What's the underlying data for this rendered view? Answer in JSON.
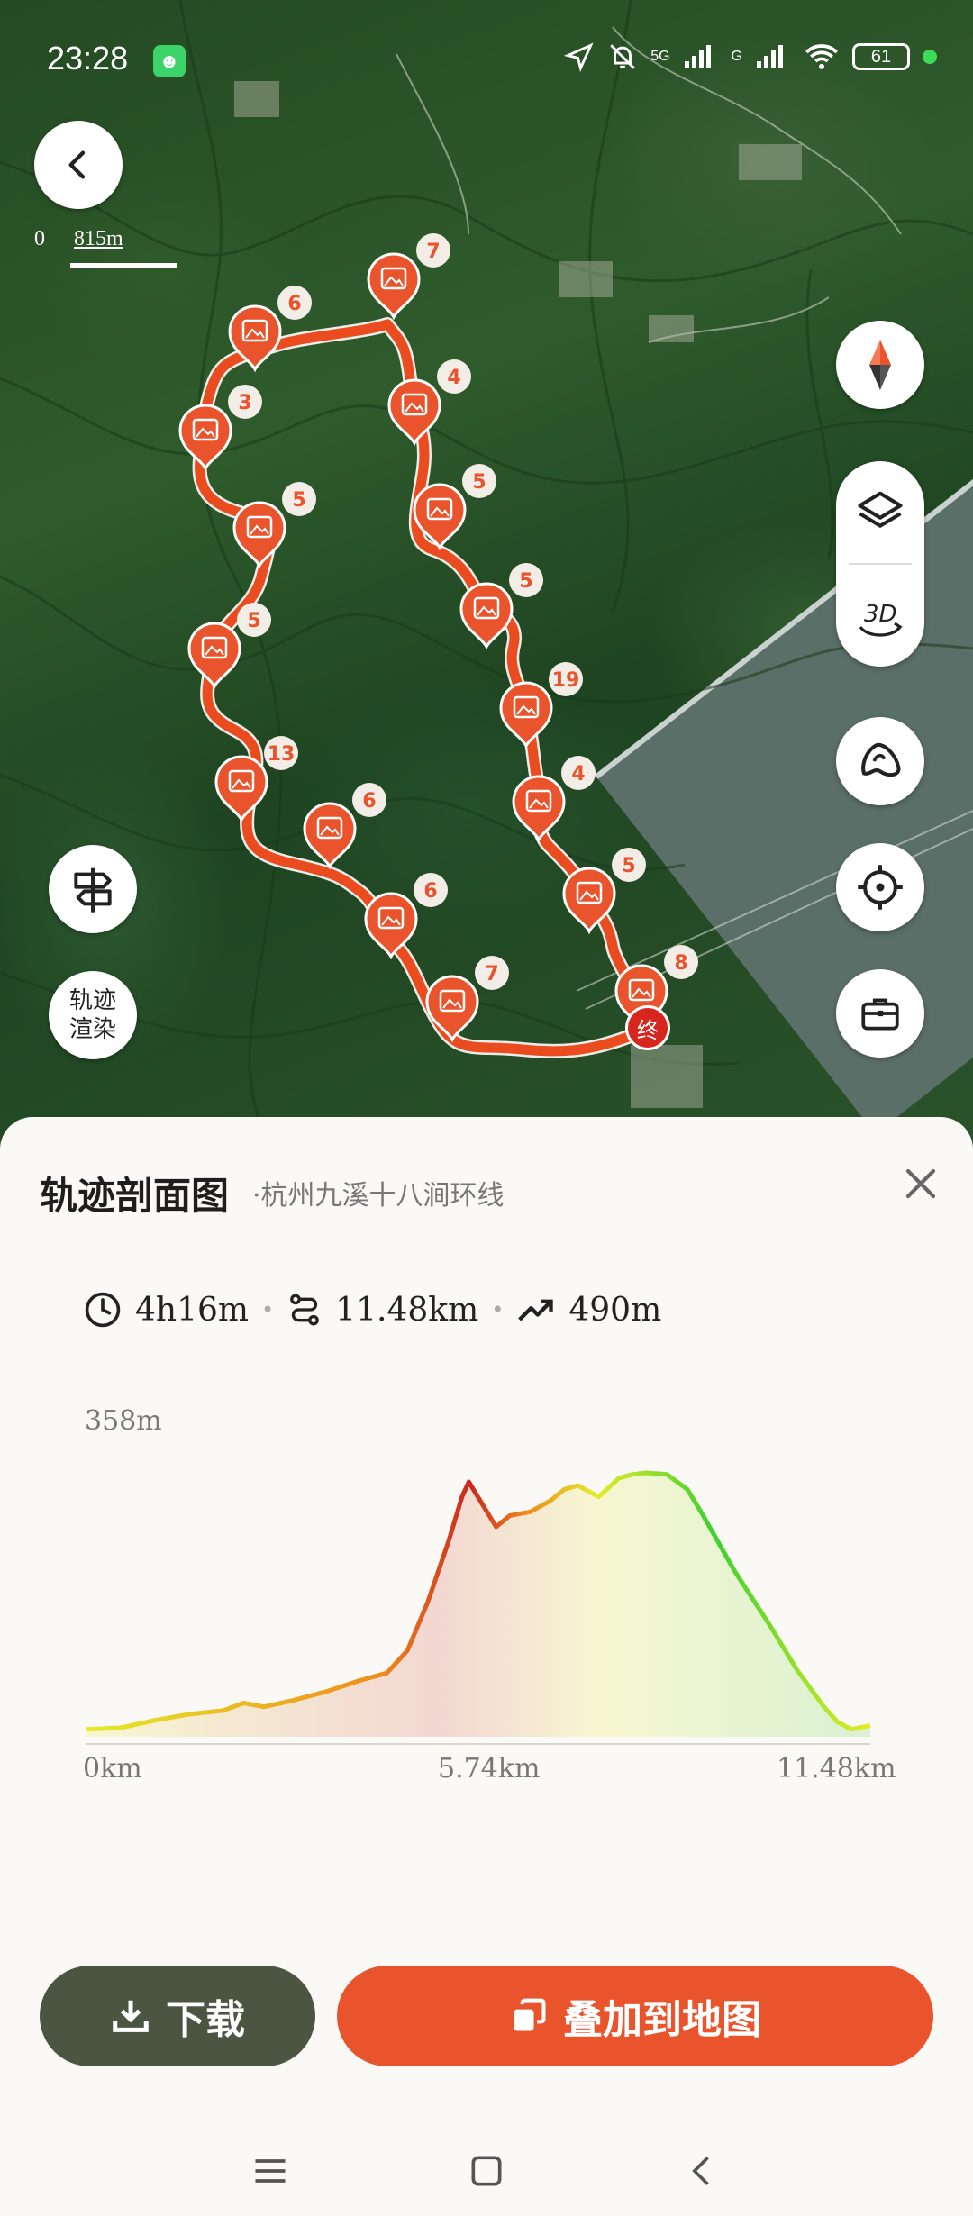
{
  "status_bar": {
    "time": "23:28",
    "network_label": "5G",
    "network_label_2": "G",
    "battery": "61"
  },
  "map": {
    "scale": {
      "zero": "0",
      "distance": "815m"
    },
    "end_marker_label": "终",
    "render_button_label_line1": "轨迹",
    "render_button_label_line2": "渲染",
    "photo_counts": [
      "7",
      "6",
      "4",
      "3",
      "5",
      "5",
      "5",
      "5",
      "19",
      "13",
      "4",
      "6",
      "5",
      "6",
      "7",
      "8"
    ],
    "icons": {
      "back": "chevron-left-icon",
      "compass": "compass-icon",
      "layers": "layers-icon",
      "view3d": "3d-view-icon",
      "terrain": "terrain-icon",
      "locate": "crosshair-icon",
      "toolbox": "toolbox-icon",
      "signpost": "signpost-icon"
    }
  },
  "sheet": {
    "title": "轨迹剖面图",
    "subtitle": "·杭州九溪十八涧环线",
    "stats": {
      "duration": "4h16m",
      "distance": "11.48km",
      "ascent": "490m"
    },
    "actions": {
      "download_label": "下载",
      "overlay_label": "叠加到地图"
    }
  },
  "chart_data": {
    "type": "area",
    "title": "",
    "xlabel": "",
    "ylabel": "",
    "y_max_label": "358m",
    "x_tick_labels": [
      "0km",
      "5.74km",
      "11.48km"
    ],
    "xlim": [
      0,
      11.48
    ],
    "ylim": [
      0,
      358
    ],
    "x": [
      0,
      0.5,
      1.0,
      1.5,
      2.0,
      2.3,
      2.6,
      3.0,
      3.5,
      4.0,
      4.4,
      4.7,
      5.0,
      5.3,
      5.5,
      5.6,
      5.8,
      6.0,
      6.2,
      6.5,
      6.8,
      7.0,
      7.2,
      7.5,
      7.8,
      8.0,
      8.2,
      8.5,
      8.8,
      9.0,
      9.5,
      10.0,
      10.4,
      10.8,
      11.0,
      11.2,
      11.48
    ],
    "y": [
      10,
      12,
      22,
      30,
      35,
      45,
      40,
      48,
      60,
      75,
      85,
      115,
      180,
      260,
      320,
      340,
      310,
      280,
      295,
      300,
      315,
      330,
      335,
      320,
      345,
      350,
      352,
      350,
      330,
      300,
      220,
      150,
      90,
      40,
      20,
      10,
      15
    ],
    "colors": {
      "low": "#e4ec2a",
      "mid": "#f08a1c",
      "high": "#c8281e",
      "descent": "#3cd12e"
    },
    "grid": false
  }
}
